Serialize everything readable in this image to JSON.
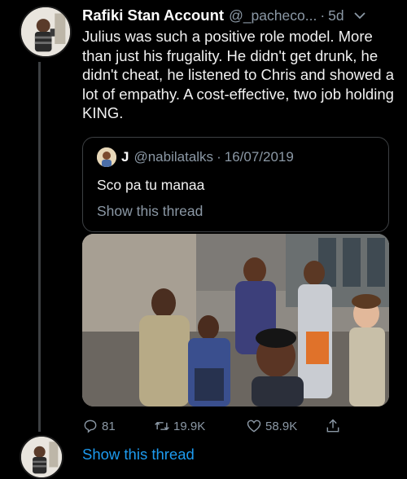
{
  "tweet": {
    "display_name": "Rafiki Stan Account",
    "handle": "@_pacheco...",
    "separator": "·",
    "time": "5d",
    "text": "Julius was such a positive role model. More than just his frugality. He didn't get drunk, he didn't cheat, he listened to Chris and showed a lot of empathy. A cost-effective, two job holding KING."
  },
  "quoted_tweet": {
    "display_name": "J",
    "handle": "@nabilatalks",
    "separator": "·",
    "date": "16/07/2019",
    "text": "Sco pa tu manaa",
    "show_thread": "Show this thread"
  },
  "actions": {
    "replies": "81",
    "retweets": "19.9K",
    "likes": "58.9K"
  },
  "thread_link": "Show this thread",
  "colors": {
    "background": "#000000",
    "primary_text": "#f1f1f1",
    "secondary_text": "#8b98a5",
    "link": "#1d9bf0",
    "border": "#3d4043"
  },
  "icons": {
    "reply": "reply-icon",
    "retweet": "retweet-icon",
    "like": "heart-icon",
    "share": "share-icon",
    "menu": "chevron-down-icon"
  }
}
